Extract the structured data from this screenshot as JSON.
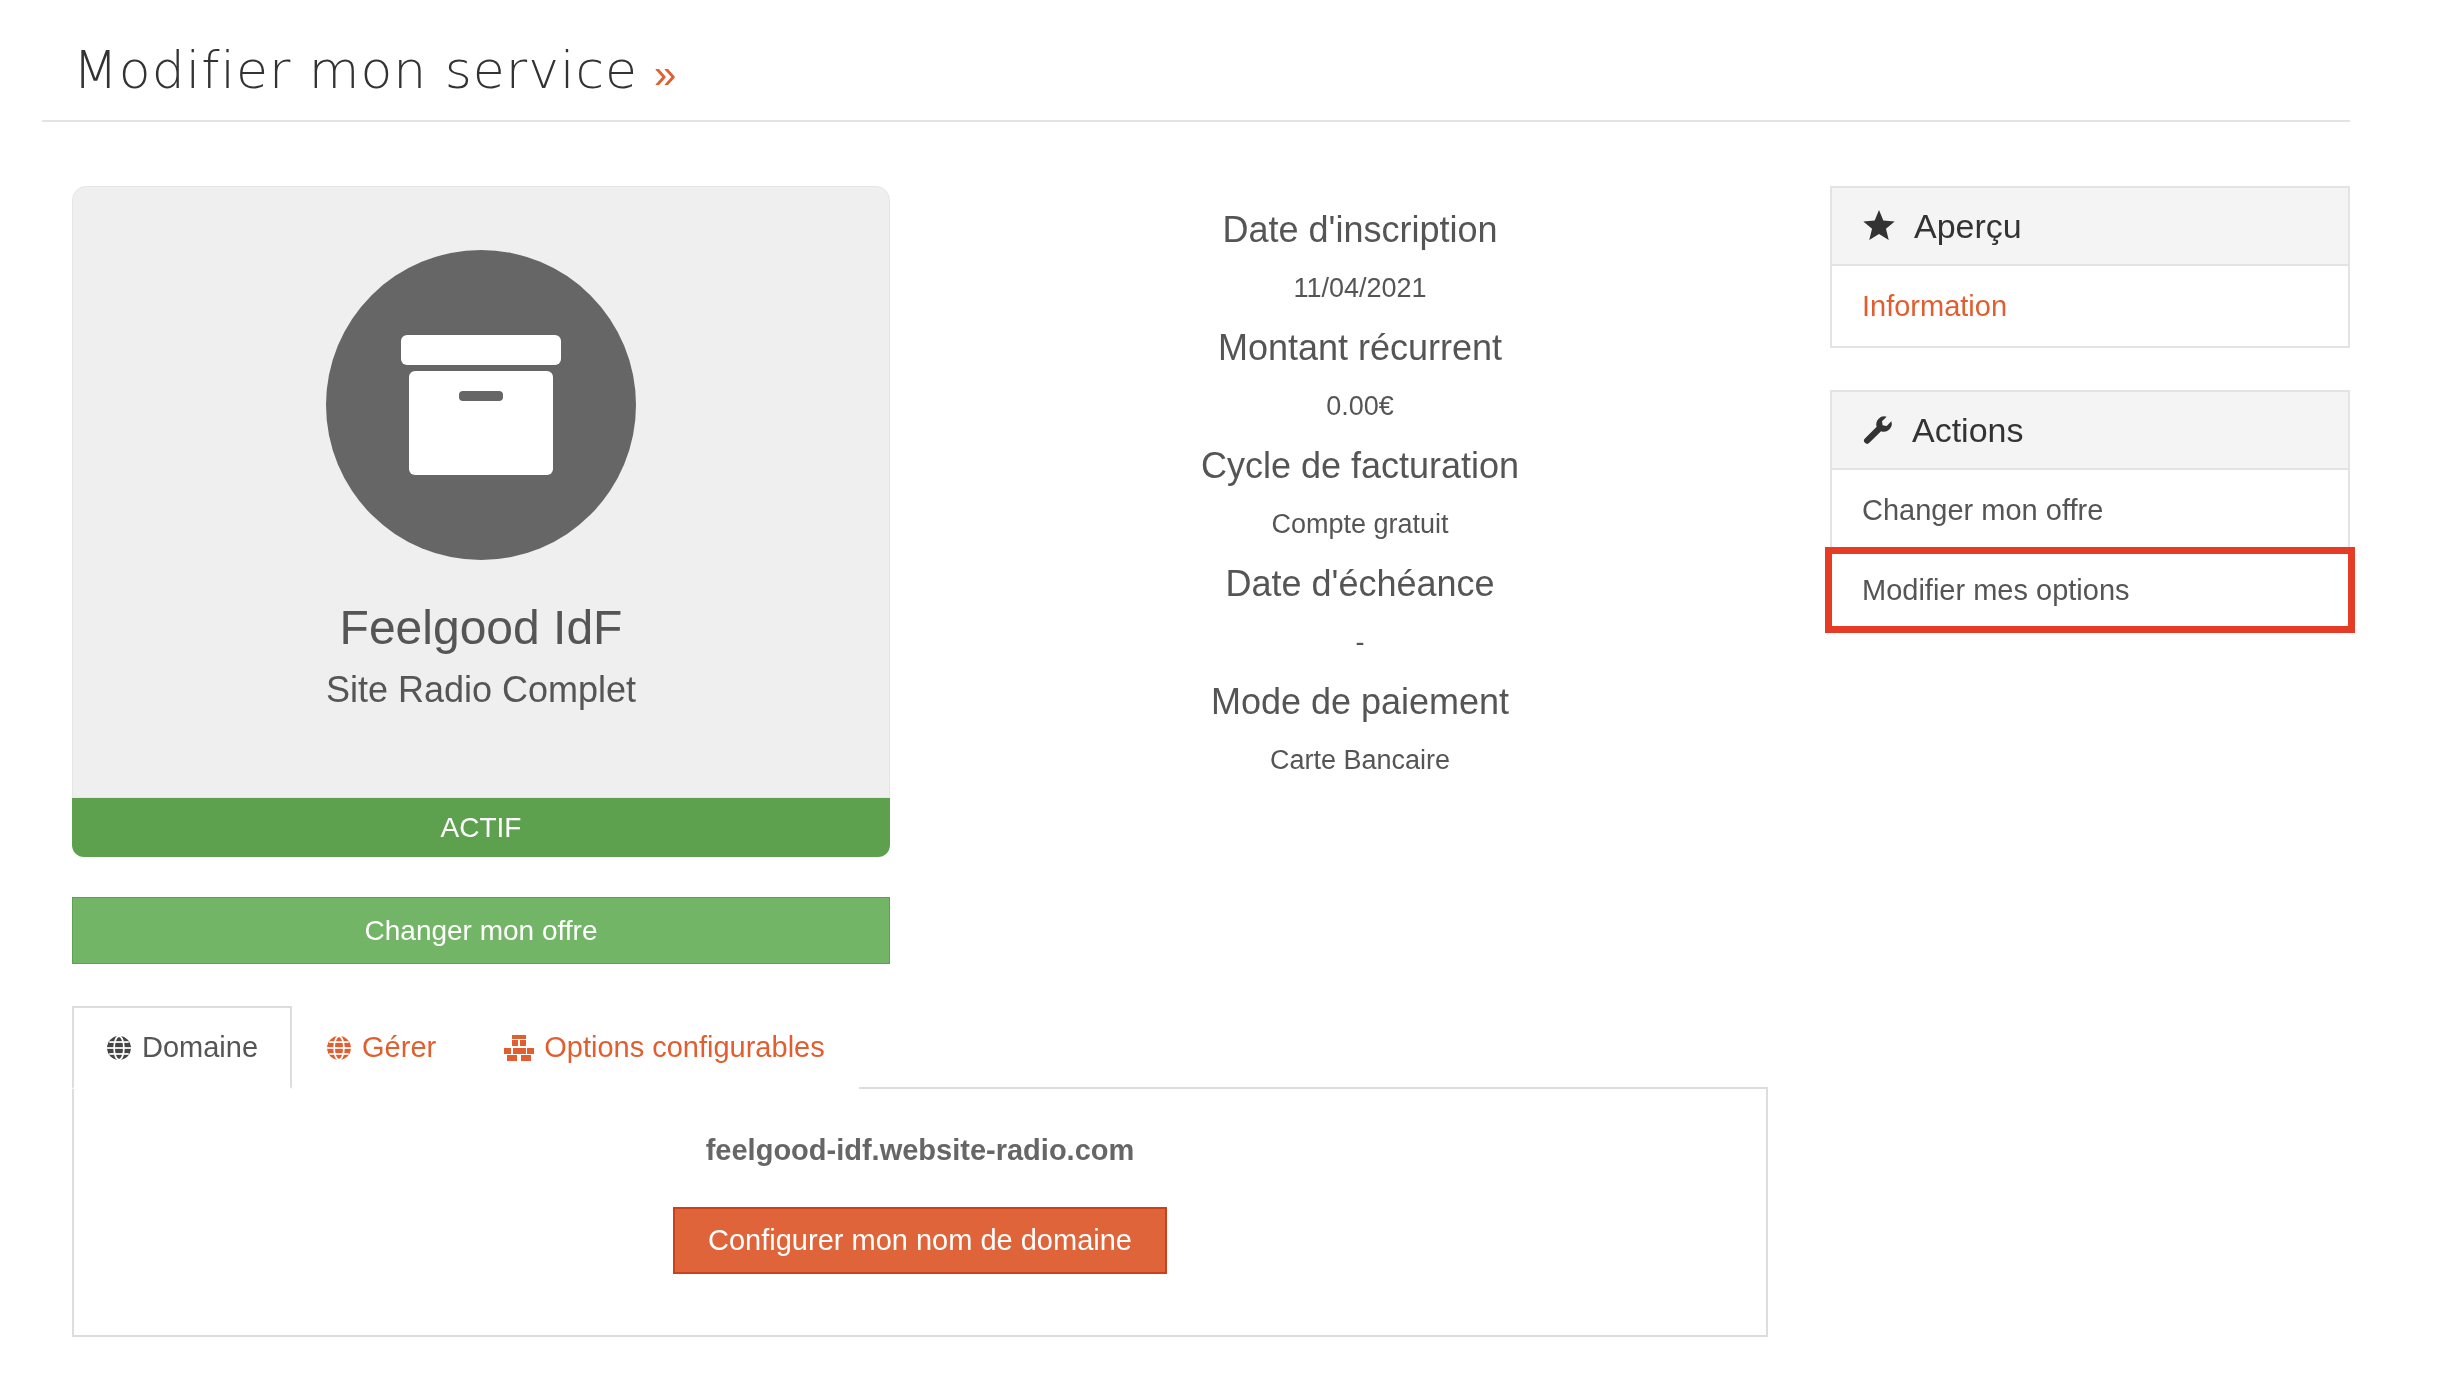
{
  "page_title": {
    "text": "Modifier mon service",
    "arrow": "»"
  },
  "service_card": {
    "name": "Feelgood IdF",
    "product": "Site Radio Complet",
    "status": "ACTIF"
  },
  "change_offer_button": "Changer mon offre",
  "details": [
    {
      "label": "Date d'inscription",
      "value": "11/04/2021"
    },
    {
      "label": "Montant récurrent",
      "value": "0.00€"
    },
    {
      "label": "Cycle de facturation",
      "value": "Compte gratuit"
    },
    {
      "label": "Date d'échéance",
      "value": "-"
    },
    {
      "label": "Mode de paiement",
      "value": "Carte Bancaire"
    }
  ],
  "sidebar": [
    {
      "title": "Aperçu",
      "items": [
        {
          "label": "Information",
          "selected": true,
          "highlighted": false
        }
      ]
    },
    {
      "title": "Actions",
      "items": [
        {
          "label": "Changer mon offre",
          "selected": false,
          "highlighted": false
        },
        {
          "label": "Modifier mes options",
          "selected": false,
          "highlighted": true
        }
      ]
    }
  ],
  "tabs": [
    {
      "label": "Domaine",
      "selected": true
    },
    {
      "label": "Gérer",
      "selected": false
    },
    {
      "label": "Options configurables",
      "selected": false
    }
  ],
  "domain_panel": {
    "domain": "feelgood-idf.website-radio.com",
    "button": "Configurer mon nom de domaine"
  }
}
